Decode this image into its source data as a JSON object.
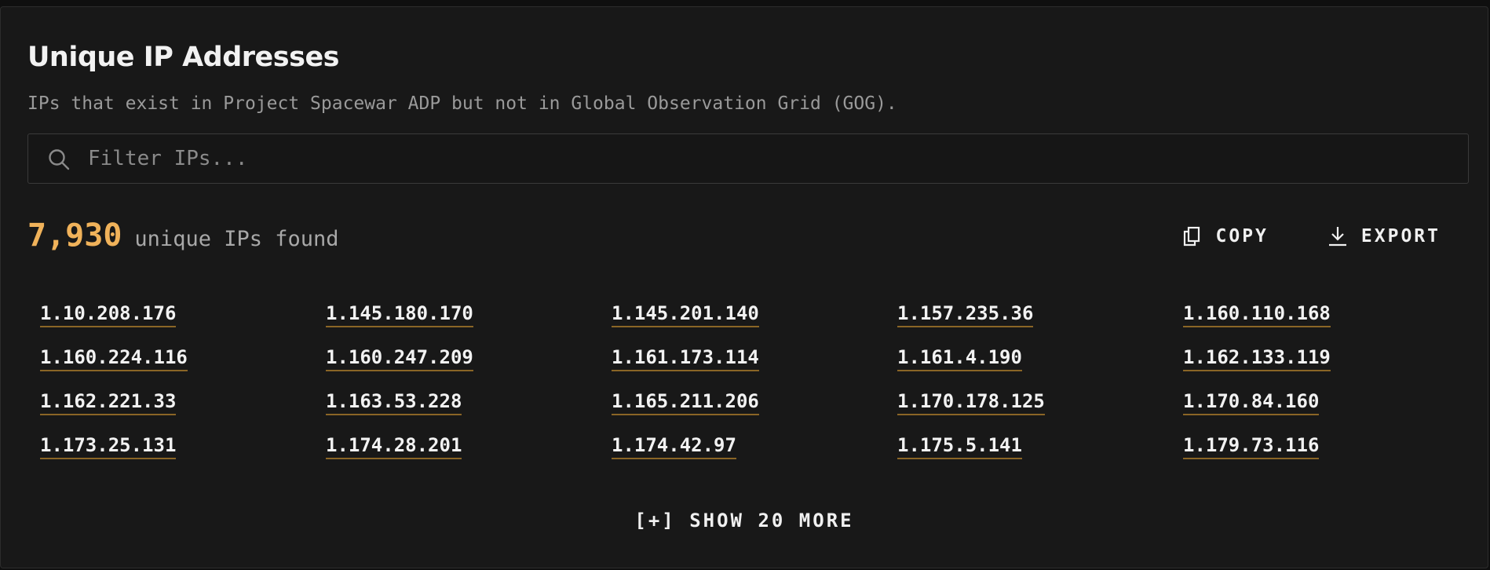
{
  "header": {
    "title": "Unique IP Addresses",
    "subtitle": "IPs that exist in Project Spacewar ADP but not in Global Observation Grid (GOG)."
  },
  "search": {
    "placeholder": "Filter IPs...",
    "value": "",
    "icon": "search-icon"
  },
  "summary": {
    "count": "7,930",
    "label": "unique IPs found"
  },
  "actions": {
    "copy_label": "COPY",
    "copy_icon": "copy-icon",
    "export_label": "EXPORT",
    "export_icon": "download-icon"
  },
  "ips": [
    "1.10.208.176",
    "1.145.180.170",
    "1.145.201.140",
    "1.157.235.36",
    "1.160.110.168",
    "1.160.224.116",
    "1.160.247.209",
    "1.161.173.114",
    "1.161.4.190",
    "1.162.133.119",
    "1.162.221.33",
    "1.163.53.228",
    "1.165.211.206",
    "1.170.178.125",
    "1.170.84.160",
    "1.173.25.131",
    "1.174.28.201",
    "1.174.42.97",
    "1.175.5.141",
    "1.179.73.116"
  ],
  "show_more_label": "[+] SHOW 20 MORE",
  "colors": {
    "accent": "#f0b25a",
    "link_underline": "#8a6526",
    "background": "#181818"
  }
}
